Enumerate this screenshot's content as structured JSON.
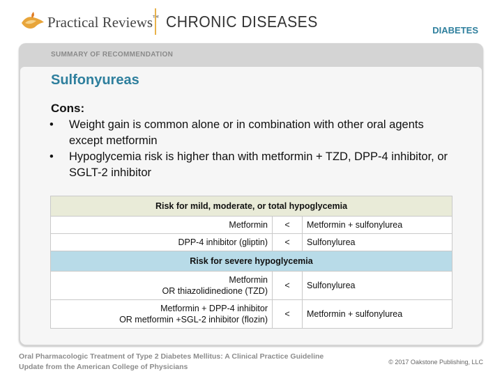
{
  "header": {
    "brand": "Practical Reviews",
    "brand_mark": "™",
    "section": "CHRONIC DISEASES",
    "category": "DIABETES"
  },
  "card": {
    "label": "SUMMARY OF RECOMMENDATION",
    "title": "Sulfonyureas",
    "cons_heading": "Cons:",
    "bullet_symbol": "•",
    "bullets": [
      "Weight gain is common alone or in combination with other oral agents except metformin",
      "Hypoglycemia risk is higher than with metformin + TZD, DPP-4 inhibitor, or SGLT-2 inhibitor"
    ]
  },
  "table": {
    "section1_header": "Risk for mild, moderate, or total hypoglycemia",
    "section1_rows": [
      {
        "left": "Metformin",
        "op": "<",
        "right": "Metformin + sulfonylurea"
      },
      {
        "left": "DPP-4 inhibitor (gliptin)",
        "op": "<",
        "right": "Sulfonylurea"
      }
    ],
    "section2_header": "Risk for severe hypoglycemia",
    "section2_rows": [
      {
        "left_line1": "Metformin",
        "left_line2": "OR thiazolidinedione (TZD)",
        "op": "<",
        "right": "Sulfonylurea"
      },
      {
        "left_line1": "Metformin + DPP-4 inhibitor",
        "left_line2": "OR metformin +SGL-2 inhibitor (flozin)",
        "op": "<",
        "right": "Metformin + sulfonylurea"
      }
    ]
  },
  "footer": {
    "citation_line1": "Oral Pharmacologic Treatment of Type 2 Diabetes Mellitus: A Clinical Practice Guideline",
    "citation_line2": "Update from the American College of Physicians",
    "copyright": "© 2017 Oakstone Publishing, LLC"
  },
  "colors": {
    "accent": "#2e7f9d",
    "divider": "#e8b24a",
    "section1_bg": "#e9ebd8",
    "section2_bg": "#b8dbe8"
  },
  "icons": {
    "logo": "oil-lamp-logo-icon"
  }
}
